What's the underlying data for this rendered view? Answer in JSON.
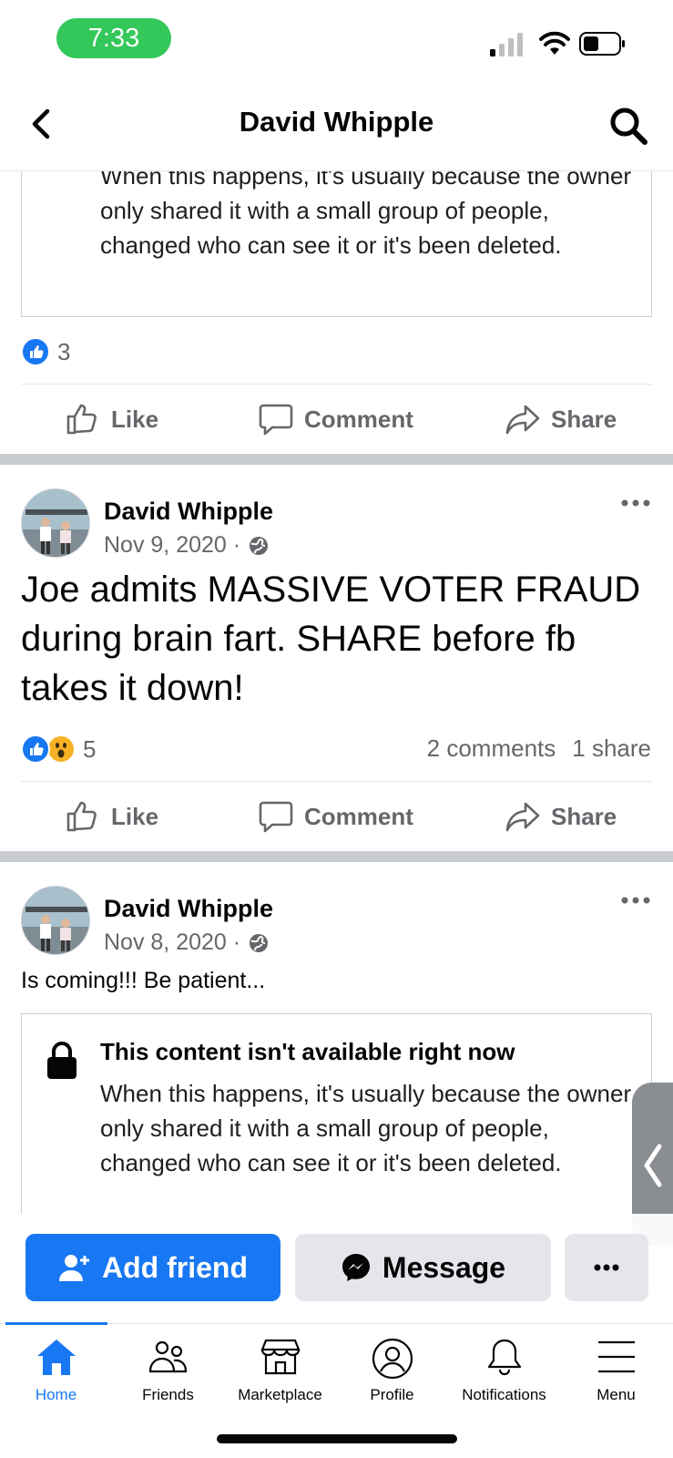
{
  "status_bar": {
    "time": "7:33"
  },
  "header": {
    "title": "David Whipple"
  },
  "shared_card_top": {
    "text": "When this happens, it's usually because the owner only shared it with a small group of people, changed who can see it or it's been deleted.",
    "reaction_count": "3"
  },
  "actions": {
    "like": "Like",
    "comment": "Comment",
    "share": "Share"
  },
  "posts": [
    {
      "author": "David Whipple",
      "date": "Nov 9, 2020 ·",
      "text": "Joe admits MASSIVE VOTER FRAUD during brain fart. SHARE before fb takes it down!",
      "reaction_count": "5",
      "comments": "2 comments",
      "shares": "1 share"
    },
    {
      "author": "David Whipple",
      "date": "Nov 8, 2020 ·",
      "text": "Is coming!!! Be patient...",
      "unavailable_title": "This content isn't available right now",
      "unavailable_body": "When this happens, it's usually because the owner only shared it with a small group of people, changed who can see it or it's been deleted."
    }
  ],
  "profile_actions": {
    "add_friend": "Add friend",
    "message": "Message"
  },
  "tabs": [
    {
      "label": "Home",
      "icon": "home-icon",
      "active": true
    },
    {
      "label": "Friends",
      "icon": "friends-icon"
    },
    {
      "label": "Marketplace",
      "icon": "marketplace-icon"
    },
    {
      "label": "Profile",
      "icon": "profile-icon"
    },
    {
      "label": "Notifications",
      "icon": "bell-icon"
    },
    {
      "label": "Menu",
      "icon": "menu-icon"
    }
  ],
  "colors": {
    "accent": "#1877f2",
    "status_pill": "#34c759",
    "muted_text": "#65676b",
    "separator": "#c9ccd1"
  }
}
